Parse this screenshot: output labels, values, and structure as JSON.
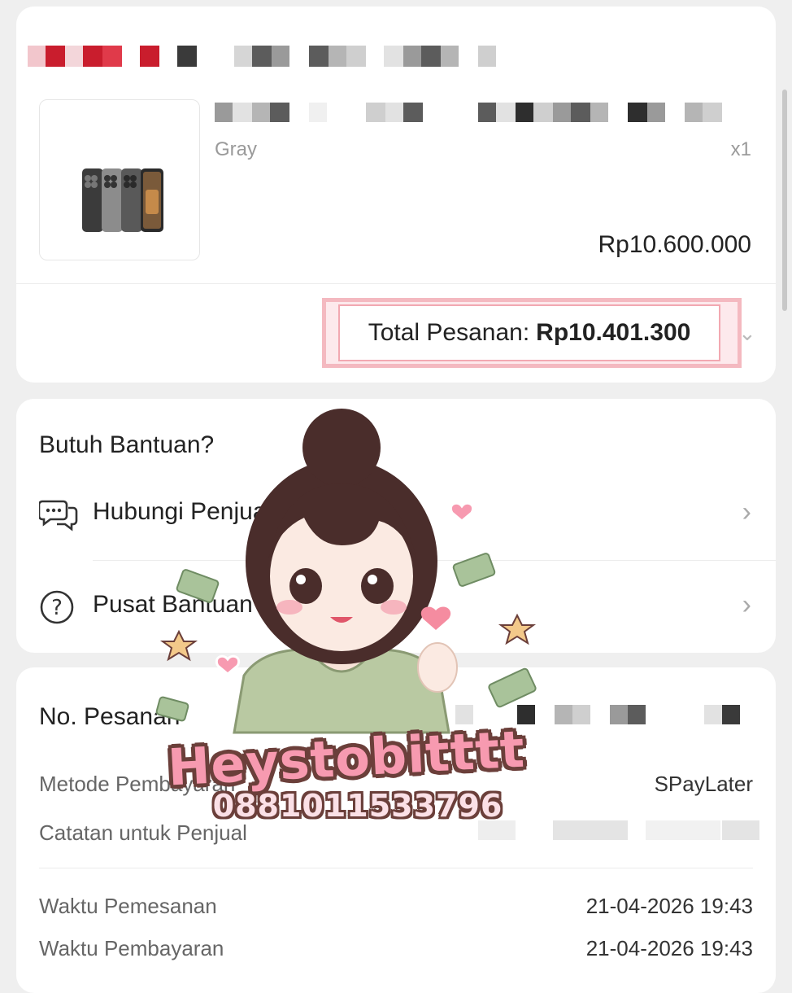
{
  "order": {
    "product_variant": "Gray",
    "product_qty": "x1",
    "product_price": "Rp10.600.000",
    "total_label": "Total Pesanan:",
    "total_value": "Rp10.401.300"
  },
  "help": {
    "title": "Butuh Bantuan?",
    "items": [
      {
        "label": "Hubungi Penjual",
        "icon": "chat-bubbles-icon"
      },
      {
        "label": "Pusat Bantuan",
        "icon": "question-circle-icon"
      }
    ]
  },
  "order_info": {
    "title": "No. Pesanan",
    "rows": [
      {
        "label": "Metode Pembayaran",
        "value": "SPayLater"
      },
      {
        "label": "Catatan untuk Penjual",
        "value": ""
      },
      {
        "label": "Waktu Pemesanan",
        "value": "21-04-2026 19:43"
      },
      {
        "label": "Waktu Pembayaran",
        "value": "21-04-2026 19:43"
      }
    ]
  },
  "watermark": {
    "name": "Heystobitttt",
    "phone": "0881011533796"
  },
  "colors": {
    "highlight_border": "#f4b9c0",
    "watermark_pink": "#f79ab0",
    "watermark_outline": "#6b3f3a"
  }
}
